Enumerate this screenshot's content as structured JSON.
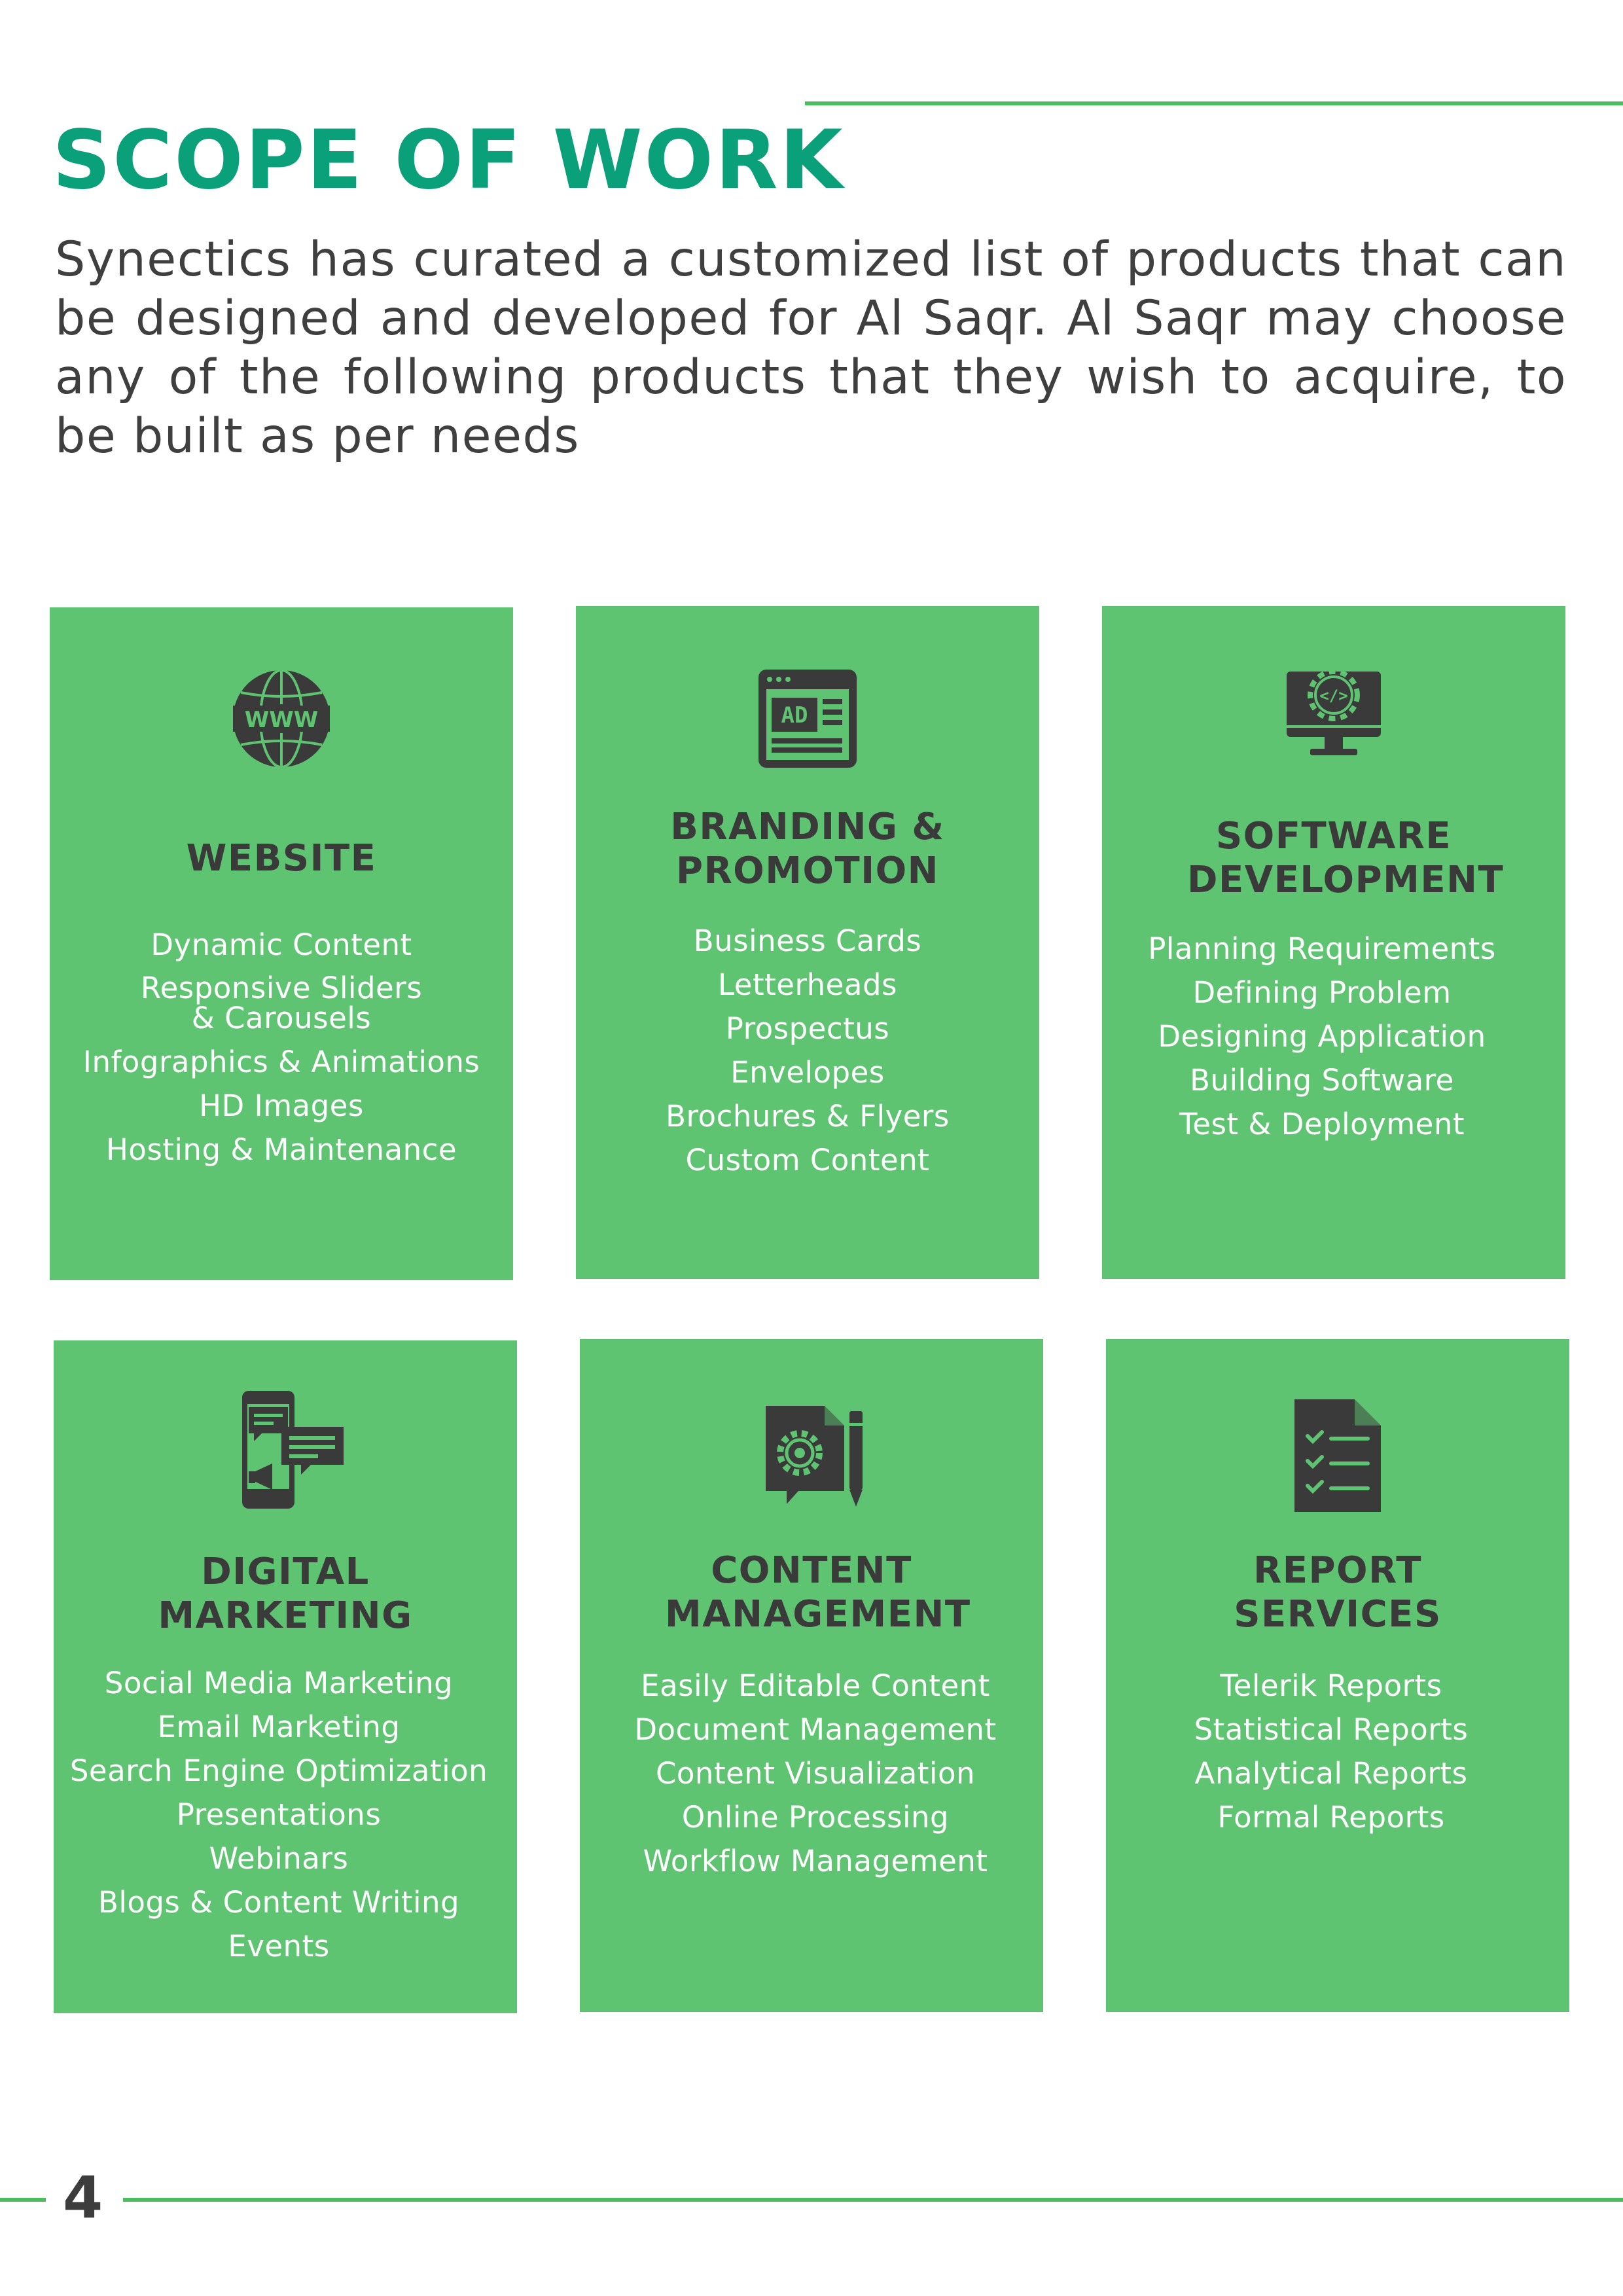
{
  "title": "SCOPE OF WORK",
  "intro": "Synectics has curated a customized list of products that can be designed and developed for Al Saqr. Al Saqr may choose any of the following products that they wish to acquire, to be built as per needs",
  "colors": {
    "title": "#0aa07a",
    "rule": "#4cbd5f",
    "card": "#5fc471",
    "heading": "#3a3a3a",
    "icon": "#3a3a3a",
    "item_text": "#ffffff"
  },
  "cards": [
    {
      "icon": "www-globe-icon",
      "heading": "WEBSITE",
      "items": [
        "Dynamic Content",
        "Responsive Sliders & Carousels",
        "Infographics & Animations",
        "HD Images",
        "Hosting & Maintenance"
      ]
    },
    {
      "icon": "ad-browser-icon",
      "heading": "BRANDING & PROMOTION",
      "items": [
        "Business Cards",
        "Letterheads",
        "Prospectus",
        "Envelopes",
        "Brochures & Flyers",
        "Custom Content"
      ]
    },
    {
      "icon": "monitor-code-gear-icon",
      "heading": "SOFTWARE DEVELOPMENT",
      "items": [
        "Planning Requirements",
        "Defining Problem",
        "Designing Application",
        "Building Software",
        "Test & Deployment"
      ]
    },
    {
      "icon": "phone-chat-megaphone-icon",
      "heading": "DIGITAL MARKETING",
      "items": [
        "Social Media Marketing",
        "Email Marketing",
        "Search Engine Optimization",
        "Presentations",
        "Webinars",
        "Blogs & Content Writing",
        "Events"
      ]
    },
    {
      "icon": "document-gear-pencil-icon",
      "heading": "CONTENT MANAGEMENT",
      "items": [
        "Easily Editable Content",
        "Document Management",
        "Content Visualization",
        "Online Processing",
        "Workflow Management"
      ]
    },
    {
      "icon": "checklist-document-icon",
      "heading": "REPORT SERVICES",
      "items": [
        "Telerik Reports",
        "Statistical Reports",
        "Analytical Reports",
        "Formal Reports"
      ]
    }
  ],
  "page_number": "4"
}
